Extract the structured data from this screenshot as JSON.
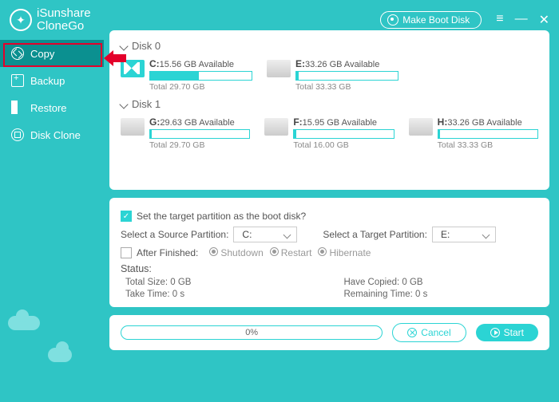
{
  "brand": {
    "line1": "iSunshare",
    "line2": "CloneGo"
  },
  "titlebar": {
    "boot_label": "Make Boot Disk"
  },
  "sidebar": {
    "items": [
      {
        "label": "Copy",
        "active": true
      },
      {
        "label": "Backup",
        "active": false
      },
      {
        "label": "Restore",
        "active": false
      },
      {
        "label": "Disk Clone",
        "active": false
      }
    ]
  },
  "disks": [
    {
      "name": "Disk 0",
      "partitions": [
        {
          "letter": "C:",
          "avail": "15.56 GB Available",
          "total": "Total 29.70 GB",
          "fill": 48,
          "win": true
        },
        {
          "letter": "E:",
          "avail": "33.26 GB Available",
          "total": "Total 33.33 GB",
          "fill": 2,
          "win": false
        }
      ]
    },
    {
      "name": "Disk 1",
      "partitions": [
        {
          "letter": "G:",
          "avail": "29.63 GB Available",
          "total": "Total 29.70 GB",
          "fill": 2,
          "win": false
        },
        {
          "letter": "F:",
          "avail": "15.95 GB Available",
          "total": "Total 16.00 GB",
          "fill": 2,
          "win": false
        },
        {
          "letter": "H:",
          "avail": "33.26 GB Available",
          "total": "Total 33.33 GB",
          "fill": 2,
          "win": false
        }
      ]
    }
  ],
  "options": {
    "boot_question": "Set the target partition as the boot disk?",
    "source_label": "Select a Source Partition:",
    "source_value": "C:",
    "target_label": "Select a Target Partition:",
    "target_value": "E:",
    "after_label": "After Finished:",
    "after_opts": [
      "Shutdown",
      "Restart",
      "Hibernate"
    ]
  },
  "status": {
    "title": "Status:",
    "total_size_label": "Total Size: 0 GB",
    "have_copied_label": "Have Copied: 0 GB",
    "take_time_label": "Take Time: 0 s",
    "remaining_label": "Remaining Time: 0 s"
  },
  "footer": {
    "progress": "0%",
    "cancel": "Cancel",
    "start": "Start"
  }
}
